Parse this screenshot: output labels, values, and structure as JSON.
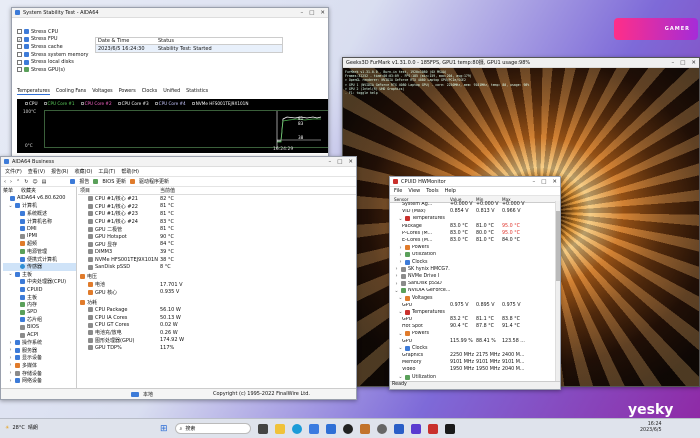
{
  "stability": {
    "title": "System Stability Test - AIDA64",
    "options": [
      {
        "label": "Stress CPU",
        "checked": false
      },
      {
        "label": "Stress FPU",
        "checked": true
      },
      {
        "label": "Stress cache",
        "checked": false
      },
      {
        "label": "Stress system memory",
        "checked": false
      },
      {
        "label": "Stress local disks",
        "checked": false
      },
      {
        "label": "Stress GPU(s)",
        "checked": false
      }
    ],
    "table_header": {
      "date": "Date & Time",
      "status": "Status"
    },
    "table_row": {
      "date": "2023/6/5 16:24:30",
      "status": "Stability Test: Started"
    },
    "tabs": [
      "Temperatures",
      "Cooling Fans",
      "Voltages",
      "Powers",
      "Clocks",
      "Unified",
      "Statistics"
    ],
    "legend": [
      "CPU",
      "CPU Core #1",
      "CPU Core #2",
      "CPU Core #3",
      "CPU Core #4",
      "NVMe HFS001TEJ9X101N"
    ],
    "y_top": "100°C",
    "y_bottom": "0°C",
    "readings": [
      "81",
      "83",
      "38"
    ],
    "time": "16:24:29"
  },
  "aida": {
    "title": "AIDA64 Business",
    "menu": [
      "文件(F)",
      "查看(V)",
      "报告(R)",
      "收藏(O)",
      "工具(T)",
      "帮助(H)"
    ],
    "toolbar": {
      "report": "报告",
      "bios": "BIOS 更新",
      "driver": "驱动程序更新"
    },
    "tree_tabs": [
      "菜单",
      "收藏夹"
    ],
    "tree": [
      {
        "label": "AIDA64 v6.80.6200",
        "indent": 0,
        "toggle": "",
        "icon": "ic"
      },
      {
        "label": "计算机",
        "indent": 1,
        "toggle": "⌄",
        "icon": "ic"
      },
      {
        "label": "系统概述",
        "indent": 2,
        "toggle": "",
        "icon": "ic"
      },
      {
        "label": "计算机名称",
        "indent": 2,
        "toggle": "",
        "icon": "ic"
      },
      {
        "label": "DMI",
        "indent": 2,
        "toggle": "",
        "icon": "ic"
      },
      {
        "label": "IPMI",
        "indent": 2,
        "toggle": "",
        "icon": "ic gy"
      },
      {
        "label": "超频",
        "indent": 2,
        "toggle": "",
        "icon": "ic or"
      },
      {
        "label": "电源管理",
        "indent": 2,
        "toggle": "",
        "icon": "ic gr"
      },
      {
        "label": "便携式计算机",
        "indent": 2,
        "toggle": "",
        "icon": "ic"
      },
      {
        "label": "传感器",
        "indent": 2,
        "toggle": "",
        "icon": "icc",
        "selected": true
      },
      {
        "label": "主板",
        "indent": 1,
        "toggle": "⌄",
        "icon": "ic"
      },
      {
        "label": "中央处理器(CPU)",
        "indent": 2,
        "toggle": "",
        "icon": "ic"
      },
      {
        "label": "CPUID",
        "indent": 2,
        "toggle": "",
        "icon": "ic"
      },
      {
        "label": "主板",
        "indent": 2,
        "toggle": "",
        "icon": "ic"
      },
      {
        "label": "内存",
        "indent": 2,
        "toggle": "",
        "icon": "ic gr"
      },
      {
        "label": "SPD",
        "indent": 2,
        "toggle": "",
        "icon": "ic gr"
      },
      {
        "label": "芯片组",
        "indent": 2,
        "toggle": "",
        "icon": "ic"
      },
      {
        "label": "BIOS",
        "indent": 2,
        "toggle": "",
        "icon": "ic gy"
      },
      {
        "label": "ACPI",
        "indent": 2,
        "toggle": "",
        "icon": "ic gy"
      },
      {
        "label": "操作系统",
        "indent": 1,
        "toggle": "›",
        "icon": "ic"
      },
      {
        "label": "服务器",
        "indent": 1,
        "toggle": "›",
        "icon": "ic"
      },
      {
        "label": "显示设备",
        "indent": 1,
        "toggle": "›",
        "icon": "ic"
      },
      {
        "label": "多媒体",
        "indent": 1,
        "toggle": "›",
        "icon": "ic or"
      },
      {
        "label": "存储设备",
        "indent": 1,
        "toggle": "›",
        "icon": "ic gy"
      },
      {
        "label": "网络设备",
        "indent": 1,
        "toggle": "›",
        "icon": "ic"
      }
    ],
    "col_item": "项目",
    "col_value": "当前值",
    "temps": [
      {
        "name": "CPU #1/核心 #21",
        "value": "82 °C"
      },
      {
        "name": "CPU #1/核心 #22",
        "value": "81 °C"
      },
      {
        "name": "CPU #1/核心 #23",
        "value": "81 °C"
      },
      {
        "name": "CPU #1/核心 #24",
        "value": "83 °C"
      },
      {
        "name": "GPU 二极管",
        "value": "81 °C"
      },
      {
        "name": "GPU Hotspot",
        "value": "90 °C"
      },
      {
        "name": "GPU 显存",
        "value": "84 °C"
      },
      {
        "name": "DIMM3",
        "value": "39 °C"
      },
      {
        "name": "NVMe HFS001TEJ9X101N",
        "value": "38 °C"
      },
      {
        "name": "SanDisk pSSD",
        "value": "8 °C"
      }
    ],
    "volt_title": "电压",
    "volts": [
      {
        "name": "电池",
        "value": "17.701 V"
      },
      {
        "name": "GPU 核心",
        "value": "0.935 V"
      }
    ],
    "power_title": "功耗",
    "powers": [
      {
        "name": "CPU Package",
        "value": "56.10 W"
      },
      {
        "name": "CPU IA Cores",
        "value": "50.13 W"
      },
      {
        "name": "CPU GT Cores",
        "value": "0.02 W"
      },
      {
        "name": "电池充/放电",
        "value": "0.26 W"
      },
      {
        "name": "图形处理器(GPU)",
        "value": "174.92 W"
      },
      {
        "name": "GPU TDP%",
        "value": "117%"
      }
    ],
    "status_left": "本地",
    "status_right": "Copyright (c) 1995-2022 FinalWire Ltd."
  },
  "furmark": {
    "title": "Geeks3D FurMark v1.31.0.0 - 185FPS, GPU1 temp:80摄, GPU1 usage:98%",
    "lines": [
      "FurMark v1.31.0.0 - Burn-in test, 1920x1080 (0X MSAA)",
      "Frames:32252 - time:00:03:09 - FPS:185 (min:159, max:204, avg:179)",
      "> OpenGL renderer: NVIDIA GeForce RTX 4080 Laptop GPU/PCIe/SSE2",
      "> GPU 1 (NVIDIA GeForce RTX 4080 Laptop GPU) - core: 2250MHz, mem: 9101MHz, temp: 80, usage: 98%",
      "> GPU 2 (Intel(R) UHD Graphics)",
      "- F1: toggle help"
    ]
  },
  "hwm": {
    "title": "CPUID HWMonitor",
    "menu": [
      "File",
      "View",
      "Tools",
      "Help"
    ],
    "headers": [
      "Sensor",
      "Value",
      "Min",
      "Max"
    ],
    "rows": [
      {
        "name": "System Ag...",
        "v": "+0.000 V",
        "min": "+0.000 V",
        "max": "+0.000 V",
        "indent": 3,
        "hot": false
      },
      {
        "name": "VID (Max)",
        "v": "0.854 V",
        "min": "0.813 V",
        "max": "0.966 V",
        "indent": 3,
        "hot": false
      },
      {
        "name": "Temperatures",
        "v": "",
        "min": "",
        "max": "",
        "indent": 2,
        "icon": "ic rd",
        "toggle": "⌄"
      },
      {
        "name": "Package",
        "v": "83.0 °C",
        "min": "81.0 °C",
        "max": "95.0 °C",
        "indent": 3,
        "hot": true
      },
      {
        "name": "P-Cores (M...",
        "v": "83.0 °C",
        "min": "80.0 °C",
        "max": "95.0 °C",
        "indent": 3,
        "hot": true
      },
      {
        "name": "E-Cores (M...",
        "v": "83.0 °C",
        "min": "81.0 °C",
        "max": "84.0 °C",
        "indent": 3,
        "hot": false
      },
      {
        "name": "Powers",
        "v": "",
        "min": "",
        "max": "",
        "indent": 2,
        "icon": "ic or",
        "toggle": "›"
      },
      {
        "name": "Utilization",
        "v": "",
        "min": "",
        "max": "",
        "indent": 2,
        "icon": "ic gr",
        "toggle": "›"
      },
      {
        "name": "Clocks",
        "v": "",
        "min": "",
        "max": "",
        "indent": 2,
        "icon": "ic",
        "toggle": "›"
      },
      {
        "name": "SK hynix HMCG7...",
        "v": "",
        "min": "",
        "max": "",
        "indent": 1,
        "icon": "ic gy",
        "toggle": "›"
      },
      {
        "name": "NVMe Drive I",
        "v": "",
        "min": "",
        "max": "",
        "indent": 1,
        "icon": "ic gy",
        "toggle": "›"
      },
      {
        "name": "SanDisk pSSD",
        "v": "",
        "min": "",
        "max": "",
        "indent": 1,
        "icon": "ic gy",
        "toggle": "›"
      },
      {
        "name": "NVIDIA GeForce...",
        "v": "",
        "min": "",
        "max": "",
        "indent": 1,
        "icon": "ic gr",
        "toggle": "⌄"
      },
      {
        "name": "Voltages",
        "v": "",
        "min": "",
        "max": "",
        "indent": 2,
        "icon": "ic or",
        "toggle": "⌄"
      },
      {
        "name": "GPU",
        "v": "0.975 V",
        "min": "0.895 V",
        "max": "0.975 V",
        "indent": 3,
        "hot": false
      },
      {
        "name": "Temperatures",
        "v": "",
        "min": "",
        "max": "",
        "indent": 2,
        "icon": "ic rd",
        "toggle": "⌄"
      },
      {
        "name": "GPU",
        "v": "83.2 °C",
        "min": "81.1 °C",
        "max": "83.8 °C",
        "indent": 3,
        "hot": false
      },
      {
        "name": "Hot Spot",
        "v": "90.4 °C",
        "min": "87.8 °C",
        "max": "91.4 °C",
        "indent": 3,
        "hot": false
      },
      {
        "name": "Powers",
        "v": "",
        "min": "",
        "max": "",
        "indent": 2,
        "icon": "ic or",
        "toggle": "⌄"
      },
      {
        "name": "GPU",
        "v": "115.99 %",
        "min": "88.41 %",
        "max": "123.58 ...",
        "indent": 3,
        "hot": false
      },
      {
        "name": "Clocks",
        "v": "",
        "min": "",
        "max": "",
        "indent": 2,
        "icon": "ic",
        "toggle": "⌄"
      },
      {
        "name": "Graphics",
        "v": "2250 MHz",
        "min": "2175 MHz",
        "max": "2400 M...",
        "indent": 3,
        "hot": false
      },
      {
        "name": "Memory",
        "v": "9101 MHz",
        "min": "9101 MHz",
        "max": "9101 M...",
        "indent": 3,
        "hot": false
      },
      {
        "name": "Video",
        "v": "1950 MHz",
        "min": "1950 MHz",
        "max": "2040 M...",
        "indent": 3,
        "hot": false
      },
      {
        "name": "Utilization",
        "v": "",
        "min": "",
        "max": "",
        "indent": 2,
        "icon": "ic gr",
        "toggle": "⌄"
      },
      {
        "name": "GPU",
        "v": "95.0 %",
        "min": "60.0 %",
        "max": "100.0 %",
        "indent": 3,
        "hot": false
      }
    ],
    "status": "Ready"
  },
  "taskbar": {
    "weather_temp": "28°C",
    "weather_desc": "晴朗",
    "search_placeholder": "搜索",
    "time": "16:24",
    "date": "2023/6/5"
  },
  "watermark": "yesky",
  "colors": {
    "accent": "#2f6fd6",
    "hot": "#e0342c",
    "graph_bg": "#000000"
  }
}
